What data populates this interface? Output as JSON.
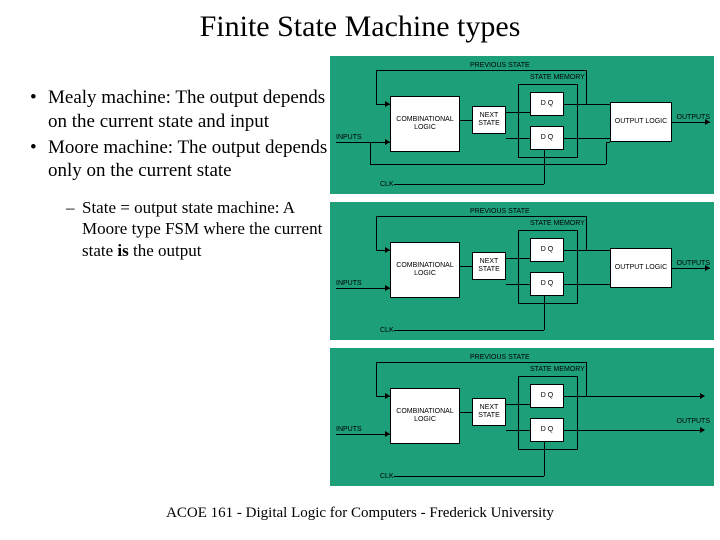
{
  "title": "Finite State Machine types",
  "bullets": {
    "b1": "Mealy machine: The output depends on the current state and input",
    "b2": "Moore machine: The output depends only on the current state",
    "sub1_pre": "State = output state machine: A Moore type FSM where the current state ",
    "sub1_bold": "is",
    "sub1_post": " the output"
  },
  "labels": {
    "previous_state": "PREVIOUS STATE",
    "inputs": "INPUTS",
    "outputs": "OUTPUTS",
    "clk": "CLK",
    "state_memory": "STATE MEMORY",
    "comb_logic": "COMBINATIONAL LOGIC",
    "next_state": "NEXT STATE",
    "output_logic": "OUTPUT LOGIC"
  },
  "footer": "ACOE 161 - Digital Logic for Computers - Frederick University"
}
